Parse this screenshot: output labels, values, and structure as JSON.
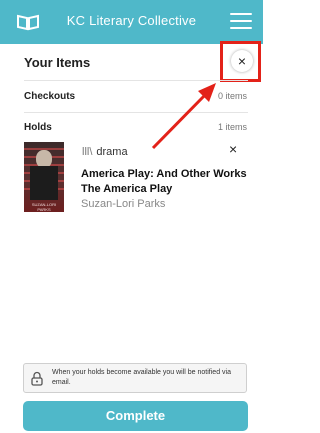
{
  "app": {
    "title": "KC Literary Collective"
  },
  "panel": {
    "heading": "Your Items",
    "close_label": "×"
  },
  "sections": {
    "checkouts": {
      "label": "Checkouts",
      "count": "0 items"
    },
    "holds": {
      "label": "Holds",
      "count": "1 items"
    }
  },
  "hold_item": {
    "format_icon": "lll\\",
    "format": "drama",
    "title": "America Play: And Other Works The America Play",
    "author": "Suzan-Lori Parks",
    "remove_label": "×",
    "cover_caption": "SUZAN-LORI PARKS"
  },
  "notice": {
    "text": "When your holds become available you will be notified via email."
  },
  "footer": {
    "complete_label": "Complete"
  },
  "colors": {
    "accent": "#4fb8c9",
    "highlight": "#e32219"
  }
}
